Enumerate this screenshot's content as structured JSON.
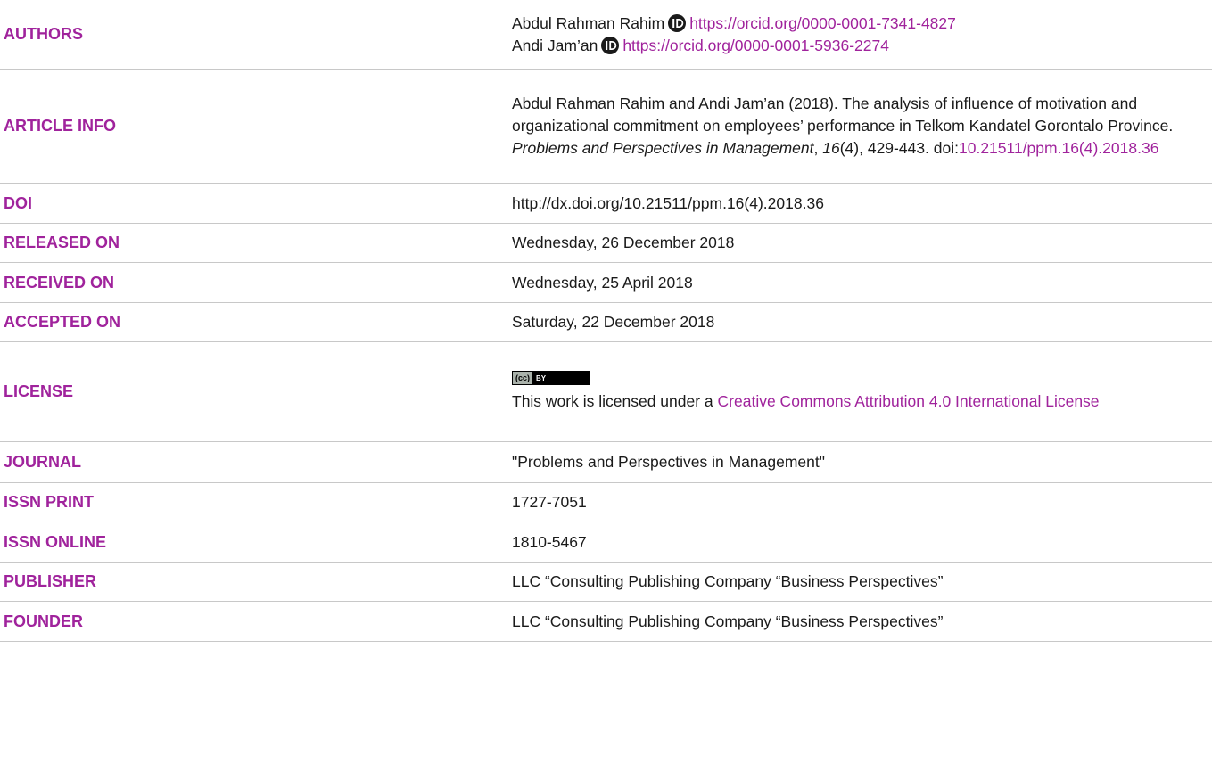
{
  "rows": [
    {
      "key": "AUTHORS"
    },
    {
      "key": "ARTICLE INFO"
    },
    {
      "key": "DOI",
      "value": "http://dx.doi.org/10.21511/ppm.16(4).2018.36"
    },
    {
      "key": "RELEASED ON",
      "value": "Wednesday, 26 December 2018"
    },
    {
      "key": "RECEIVED ON",
      "value": "Wednesday, 25 April 2018"
    },
    {
      "key": "ACCEPTED ON",
      "value": "Saturday, 22 December 2018"
    },
    {
      "key": "LICENSE"
    },
    {
      "key": "JOURNAL",
      "value": "\"Problems and Perspectives in Management\""
    },
    {
      "key": "ISSN PRINT",
      "value": "1727-7051"
    },
    {
      "key": "ISSN ONLINE",
      "value": "1810-5467"
    },
    {
      "key": "PUBLISHER",
      "value": "LLC “Consulting Publishing Company “Business Perspectives”"
    },
    {
      "key": "FOUNDER",
      "value": "LLC “Consulting Publishing Company “Business Perspectives”"
    }
  ],
  "authors": [
    {
      "name": "Abdul Rahman Rahim",
      "orcid_url": "https://orcid.org/0000-0001-7341-4827"
    },
    {
      "name": "Andi Jam’an",
      "orcid_url": "https://orcid.org/0000-0001-5936-2274"
    }
  ],
  "article_info": {
    "citation_start": "Abdul Rahman Rahim and Andi Jam’an (2018). The analysis of influence of motivation and organizational commitment on employees’ performance in Telkom Kandatel Gorontalo Province. ",
    "journal_italic": "Problems and Perspectives in Management",
    "comma": ", ",
    "volume_italic": "16",
    "issue_pages": "(4), 429-443. doi:",
    "doi_link": "10.21511/ppm.16(4).2018.36"
  },
  "license": {
    "badge_left": "(cc)",
    "badge_right": "BY",
    "text_prefix": "This work is licensed under a ",
    "link_text": "Creative Commons Attribution 4.0 International License"
  },
  "colors": {
    "accent": "#a0239c",
    "text": "#1a1a1a",
    "divider": "#c8c8c8"
  },
  "icons": {
    "orcid": "orcid-icon",
    "cc_badge": "cc-by-badge"
  }
}
